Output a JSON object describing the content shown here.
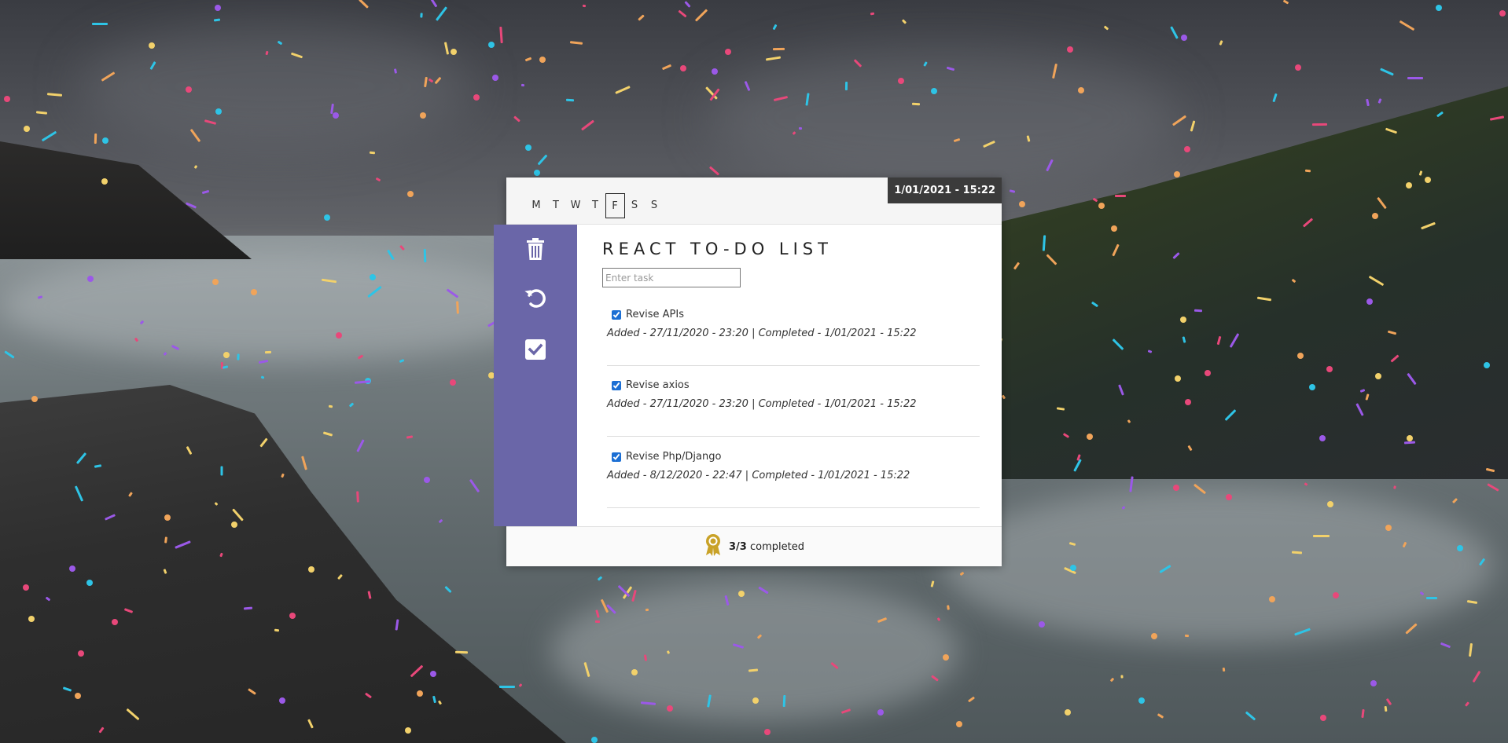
{
  "header": {
    "days": [
      "M",
      "T",
      "W",
      "T",
      "F",
      "S",
      "S"
    ],
    "current_day_index": 4,
    "datetime": "1/01/2021 - 15:22"
  },
  "sidebar": {
    "icons": [
      "trash-icon",
      "undo-icon",
      "check-square-icon"
    ],
    "accent": "#6a66a8"
  },
  "main": {
    "title": "REACT TO-DO LIST",
    "input_placeholder": "Enter task",
    "tasks": [
      {
        "name": "Revise APIs",
        "checked": true,
        "meta": "Added - 27/11/2020 - 23:20 | Completed - 1/01/2021 - 15:22"
      },
      {
        "name": "Revise axios",
        "checked": true,
        "meta": "Added - 27/11/2020 - 23:20 | Completed - 1/01/2021 - 15:22"
      },
      {
        "name": "Revise Php/Django",
        "checked": true,
        "meta": "Added - 8/12/2020 - 22:47 | Completed - 1/01/2021 - 15:22"
      }
    ]
  },
  "footer": {
    "count": "3/3",
    "label": "completed",
    "icon": "award-icon",
    "icon_color": "#c9a227"
  }
}
